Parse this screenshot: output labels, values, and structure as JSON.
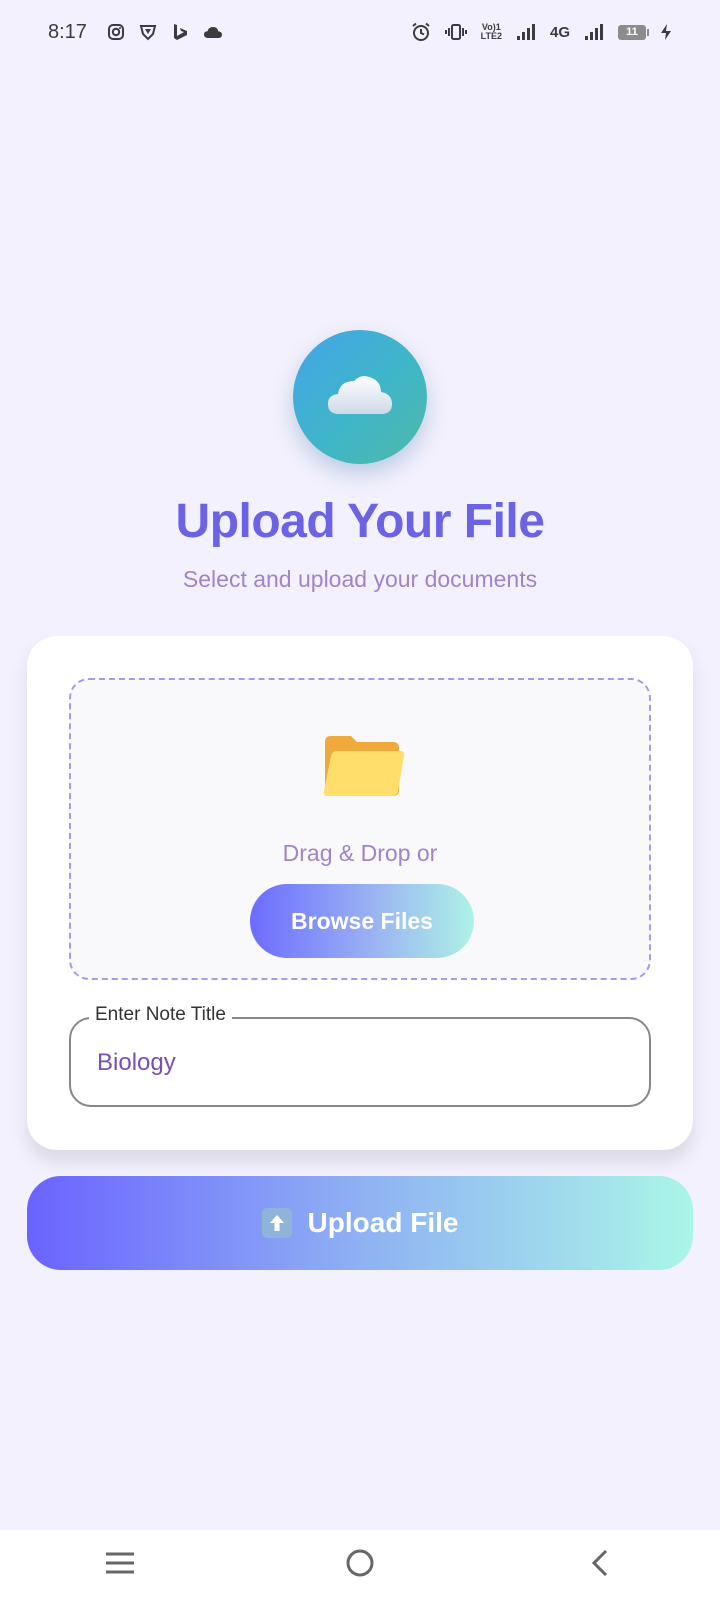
{
  "status_bar": {
    "time": "8:17",
    "lte_label_top": "Vo)1",
    "lte_label_bottom": "LTE2",
    "network": "4G",
    "battery_level": "11"
  },
  "hero": {
    "icon": "cloud-icon",
    "title": "Upload Your File",
    "subtitle": "Select and upload your documents"
  },
  "drop_zone": {
    "icon": "folder-icon",
    "text": "Drag & Drop or",
    "browse_label": "Browse Files"
  },
  "note_title": {
    "label": "Enter Note Title",
    "value": "Biology"
  },
  "upload_button": {
    "icon": "up-arrow-icon",
    "label": "Upload File"
  },
  "nav": {
    "menu": "menu-icon",
    "home": "home-icon",
    "back": "back-icon"
  },
  "colors": {
    "background": "#f3f1fd",
    "title": "#6b62e6",
    "subtitle": "#a183c8",
    "gradient_start": "#6a63ff",
    "gradient_end": "#aaf6e8"
  }
}
